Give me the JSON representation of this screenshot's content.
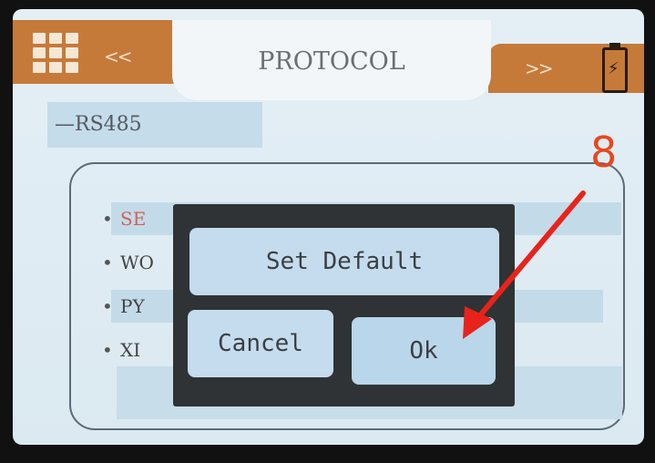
{
  "header": {
    "title": "PROTOCOL",
    "prev_label": "<<",
    "next_label": ">>",
    "battery_icon": "battery-charging-icon",
    "menu_icon": "grid-menu-icon"
  },
  "section": {
    "label": "RS485"
  },
  "list": {
    "items": [
      {
        "label": "SE",
        "active": true
      },
      {
        "label": "WO",
        "active": false
      },
      {
        "label": "PY",
        "active": false
      },
      {
        "label": "XI",
        "active": false
      }
    ]
  },
  "dialog": {
    "set_default_label": "Set Default",
    "cancel_label": "Cancel",
    "ok_label": "Ok"
  },
  "annotation": {
    "step_number": "8",
    "color": "#e8471c"
  },
  "colors": {
    "header_accent": "#c57a3a",
    "screen_bg": "#e4eff5",
    "button_bg": "#c4dced",
    "dialog_bg": "#2f3335"
  }
}
